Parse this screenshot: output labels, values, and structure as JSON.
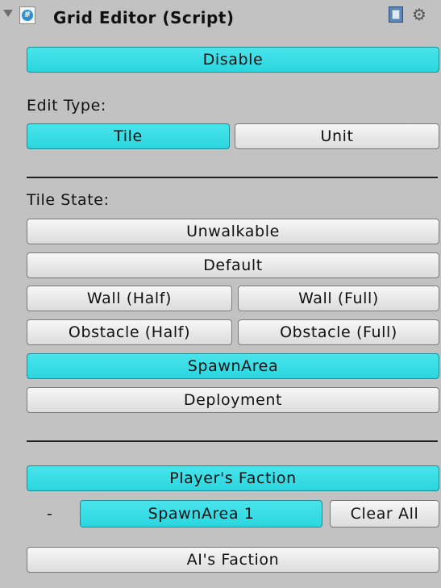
{
  "header": {
    "title": "Grid Editor (Script)"
  },
  "buttons": {
    "disable": "Disable",
    "tile": "Tile",
    "unit": "Unit",
    "unwalkable": "Unwalkable",
    "default": "Default",
    "wall_half": "Wall (Half)",
    "wall_full": "Wall (Full)",
    "obstacle_half": "Obstacle (Half)",
    "obstacle_full": "Obstacle (Full)",
    "spawn_area": "SpawnArea",
    "deployment": "Deployment",
    "players_faction": "Player's Faction",
    "spawn_area_1": "SpawnArea 1",
    "clear_all": "Clear All",
    "ais_faction": "AI's Faction"
  },
  "labels": {
    "edit_type": "Edit Type:",
    "tile_state": "Tile State:",
    "dash": "-"
  },
  "colors": {
    "panel_bg": "#c2c2c2",
    "accent": "#2bd6de"
  },
  "icons": {
    "foldout": "triangle-down-icon",
    "script": "script-icon",
    "help": "help-book-icon",
    "settings": "gear-icon"
  }
}
